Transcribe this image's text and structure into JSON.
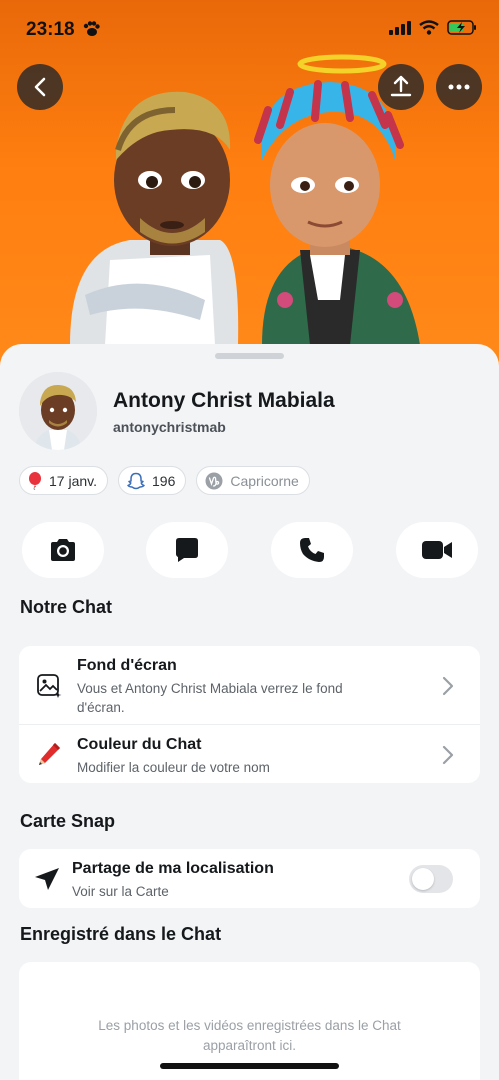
{
  "status_bar": {
    "time": "23:18",
    "icons": [
      "paw-icon",
      "signal-icon",
      "wifi-icon",
      "battery-charging-icon"
    ]
  },
  "header": {
    "back_icon": "chevron-left-icon",
    "share_icon": "upload-icon",
    "more_icon": "more-horizontal-icon"
  },
  "profile": {
    "name": "Antony Christ Mabiala",
    "username": "antonychristmab",
    "chips": [
      {
        "icon": "balloon-icon",
        "label": "17 janv."
      },
      {
        "icon": "snapchat-ghost-icon",
        "label": "196"
      },
      {
        "icon": "capricorn-icon",
        "label": "Capricorne"
      }
    ]
  },
  "actions": [
    {
      "icon": "camera-icon"
    },
    {
      "icon": "chat-icon"
    },
    {
      "icon": "phone-icon"
    },
    {
      "icon": "video-icon"
    }
  ],
  "notre_chat": {
    "title": "Notre Chat",
    "items": [
      {
        "icon": "wallpaper-icon",
        "title": "Fond d'écran",
        "subtitle_line1": "Vous et Antony Christ Mabiala verrez le fond",
        "subtitle_line2": "d'écran."
      },
      {
        "icon": "pencil-icon",
        "title": "Couleur du Chat",
        "subtitle_line1": "Modifier la couleur de votre nom"
      }
    ]
  },
  "carte_snap": {
    "title": "Carte Snap",
    "item": {
      "icon": "location-arrow-icon",
      "title": "Partage de ma localisation",
      "subtitle": "Voir sur la Carte",
      "toggle_on": false
    }
  },
  "saved": {
    "title": "Enregistré dans le Chat",
    "empty_line1": "Les photos et les vidéos enregistrées dans le Chat",
    "empty_line2": "apparaîtront ici."
  },
  "colors": {
    "hero_orange": "#ff7f10",
    "sheet_bg": "#f3f4f6",
    "card_bg": "#ffffff",
    "text_primary": "#16191c",
    "text_secondary": "#5d6369"
  }
}
